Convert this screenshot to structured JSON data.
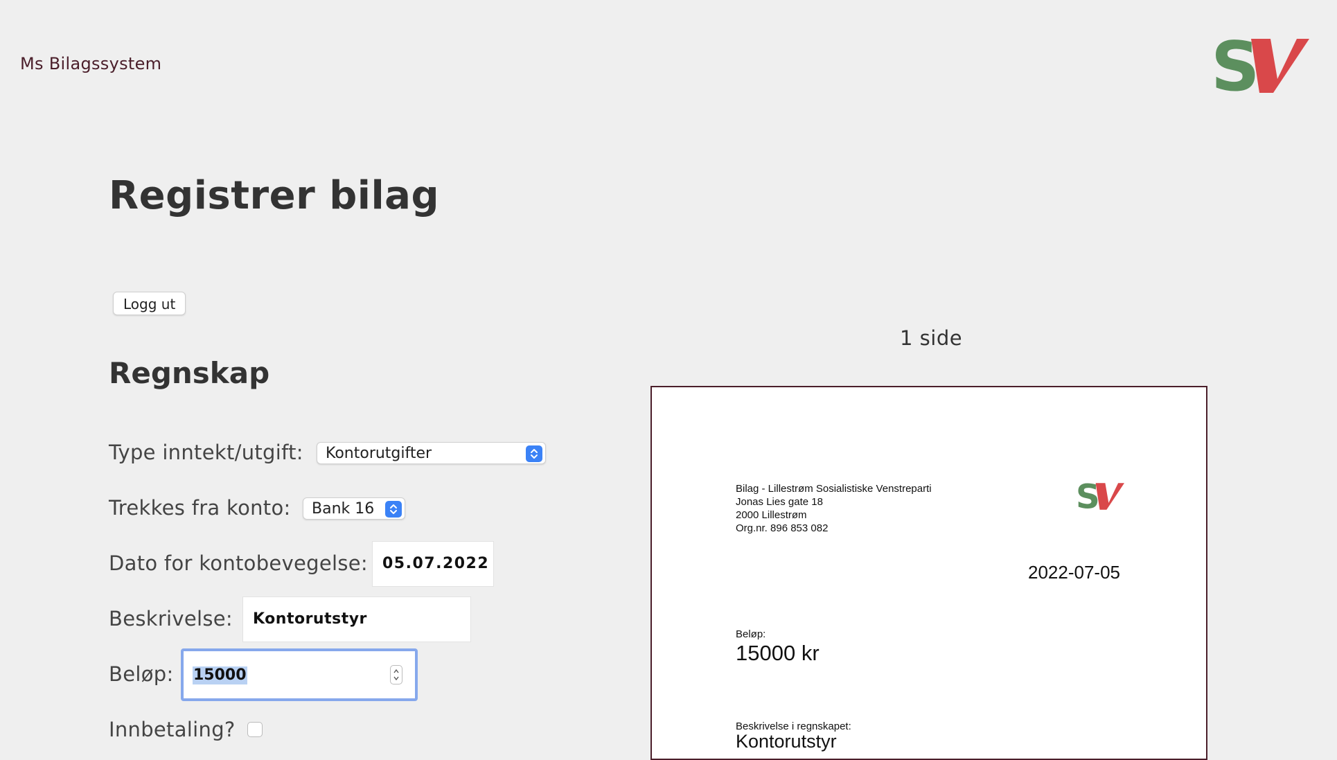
{
  "header": {
    "app_title": "Ms Bilagssystem",
    "logo_text": "SV",
    "logo_colors": {
      "s": "#5c8f5e",
      "v": "#d9484a"
    }
  },
  "page": {
    "title": "Registrer bilag",
    "logout_label": "Logg ut",
    "section_title": "Regnskap"
  },
  "form": {
    "type_label": "Type inntekt/utgift:",
    "type_value": "Kontorutgifter",
    "account_label": "Trekkes fra konto:",
    "account_value": "Bank 16",
    "date_label": "Dato for kontobevegelse:",
    "date_value": "05.07.2022",
    "description_label": "Beskrivelse:",
    "description_value": "Kontorutstyr",
    "amount_label": "Beløp:",
    "amount_value": "15000",
    "payment_label": "Innbetaling?",
    "payment_checked": false
  },
  "preview": {
    "page_count": "1 side",
    "org_lines": [
      "Bilag - Lillestrøm Sosialistiske Venstreparti",
      "Jonas Lies gate 18",
      "2000 Lillestrøm",
      "Org.nr. 896 853 082"
    ],
    "date": "2022-07-05",
    "amount_label": "Beløp:",
    "amount_value": "15000 kr",
    "description_label": "Beskrivelse i regnskapet:",
    "description_value": "Kontorutstyr"
  },
  "colors": {
    "background": "#efefef",
    "accent_blue": "#3b82f6",
    "focus_ring": "#86a8ec",
    "preview_border": "#4a1e2a"
  }
}
